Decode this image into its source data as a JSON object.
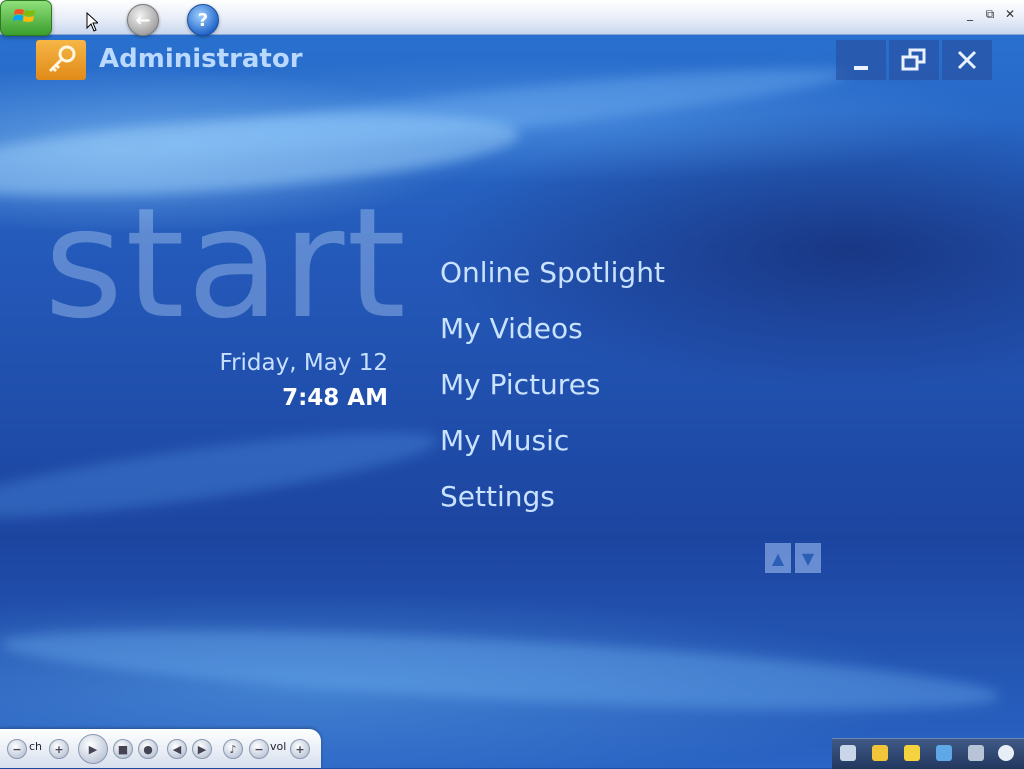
{
  "window": {
    "minimize_symbol": "_",
    "restore_symbol": "⧉",
    "close_symbol": "✕"
  },
  "toolbar": {
    "back_symbol": "←",
    "help_symbol": "?"
  },
  "user": {
    "name": "Administrator",
    "icon": "key-icon"
  },
  "start_label": "start",
  "clock": {
    "date": "Friday, May 12",
    "time": "7:48 AM"
  },
  "menu": {
    "items": [
      {
        "label": "Online Spotlight"
      },
      {
        "label": "My Videos"
      },
      {
        "label": "My Pictures"
      },
      {
        "label": "My Music"
      },
      {
        "label": "Settings"
      }
    ]
  },
  "scroll": {
    "up": "▲",
    "down": "▼"
  },
  "transport": {
    "ch_label": "ch",
    "vol_label": "vol"
  },
  "colors": {
    "accent": "#2458b8",
    "menu_text": "#c9e2ff",
    "start_orb": "#3a9e2d",
    "user_tile": "#e08a18"
  }
}
